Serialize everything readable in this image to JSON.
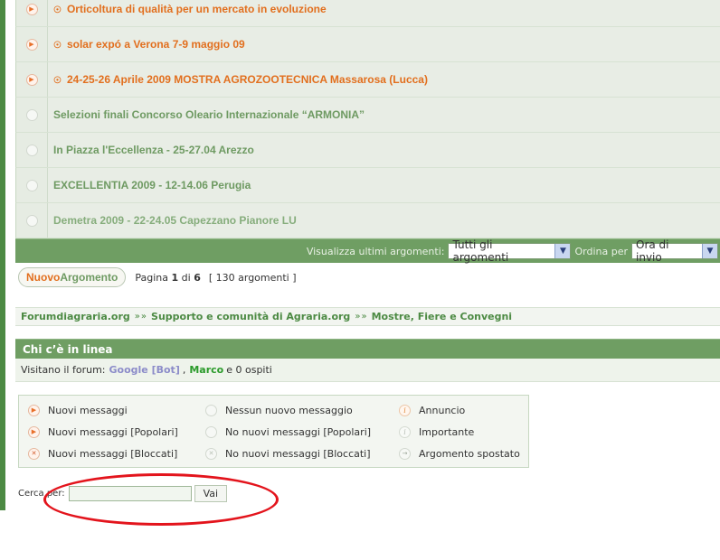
{
  "topics": [
    {
      "title": "Orticoltura di qualità per un mercato in evoluzione",
      "status": "new",
      "sticky": true
    },
    {
      "title": "solar expó a Verona 7-9 maggio 09",
      "status": "new",
      "sticky": true
    },
    {
      "title": "24-25-26 Aprile 2009 MOSTRA AGROZOOTECNICA Massarosa (Lucca)",
      "status": "new",
      "sticky": true
    },
    {
      "title": "Selezioni finali Concorso Oleario Internazionale “ARMONIA”",
      "status": "old",
      "sticky": false
    },
    {
      "title": "In Piazza l'Eccellenza - 25-27.04 Arezzo",
      "status": "old",
      "sticky": false
    },
    {
      "title": "EXCELLENTIA 2009 - 12-14.06 Perugia",
      "status": "old",
      "sticky": false
    },
    {
      "title": "Demetra 2009 - 22-24.05 Capezzano Pianore LU",
      "status": "old",
      "sticky": false
    }
  ],
  "filter": {
    "show_label": "Visualizza ultimi argomenti:",
    "show_value": "Tutti gli argomenti",
    "sort_label": "Ordina per",
    "sort_value": "Ora di invio"
  },
  "pagination": {
    "new_topic_part1": "Nuovo",
    "new_topic_part2": "Argomento",
    "page_label": "Pagina",
    "current": "1",
    "of": "di",
    "total": "6",
    "count_text": "[ 130 argomenti ]"
  },
  "breadcrumb": {
    "items": [
      "Forumdiagraria.org",
      "Supporto e comunità di Agraria.org",
      "Mostre, Fiere e Convegni"
    ],
    "separator": "»"
  },
  "online": {
    "heading": "Chi c’è in linea",
    "prefix": "Visitano il forum:",
    "user1": "Google [Bot]",
    "comma": ",",
    "user2": "Marco",
    "suffix": "e 0 ospiti"
  },
  "legend": {
    "new_posts": "Nuovi messaggi",
    "no_new_posts": "Nessun nuovo messaggio",
    "announcement": "Annuncio",
    "new_posts_hot": "Nuovi messaggi [Popolari]",
    "no_new_posts_hot": "No nuovi messaggi [Popolari]",
    "important": "Importante",
    "new_posts_locked": "Nuovi messaggi [Bloccati]",
    "no_new_posts_locked": "No nuovi messaggi [Bloccati]",
    "moved": "Argomento spostato"
  },
  "search": {
    "label": "Cerca per:",
    "button": "Vai",
    "value": ""
  },
  "colors": {
    "accent_green": "#6f9e63",
    "link_orange": "#e26f1e",
    "annotation_red": "#e3141c"
  }
}
